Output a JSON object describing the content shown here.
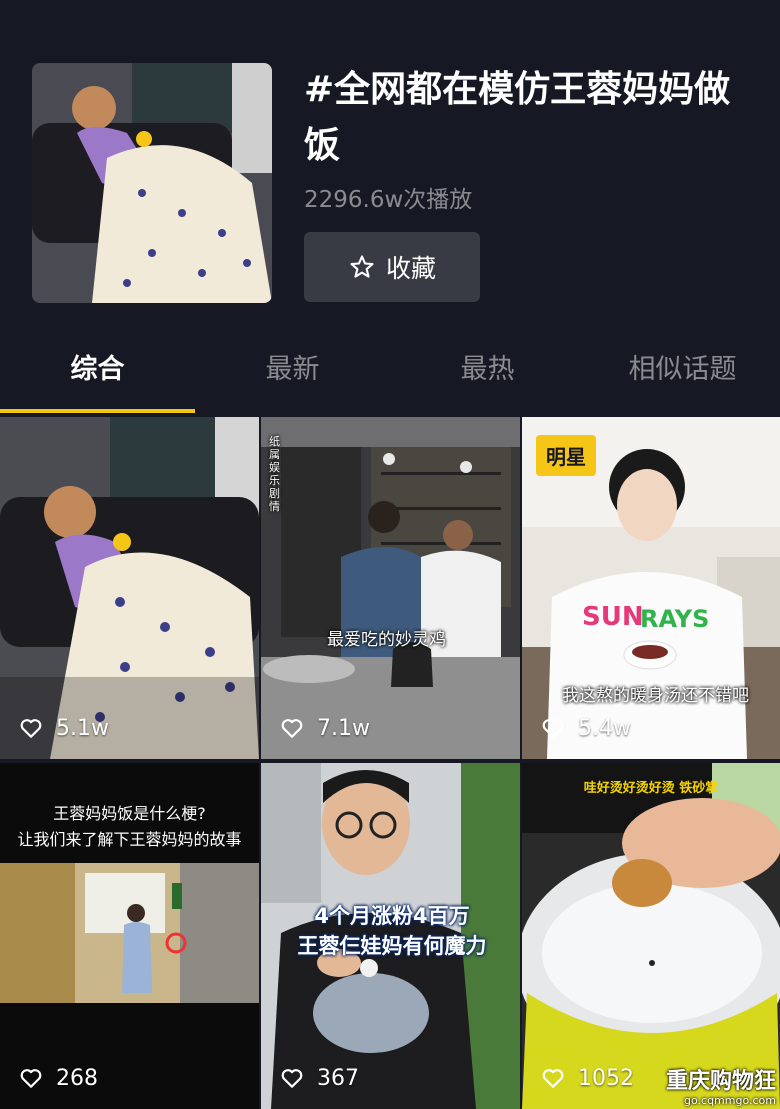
{
  "topic": {
    "title": "#全网都在模仿王蓉妈妈做饭",
    "plays": "2296.6w次播放",
    "favorite_label": "收藏"
  },
  "tabs": [
    {
      "label": "综合",
      "active": true
    },
    {
      "label": "最新",
      "active": false
    },
    {
      "label": "最热",
      "active": false
    },
    {
      "label": "相似话题",
      "active": false
    }
  ],
  "videos": [
    {
      "likes": "5.1w"
    },
    {
      "likes": "7.1w",
      "caption": "最爱吃的妙灵鸡",
      "side_text": "纸属娱乐剧情"
    },
    {
      "likes": "5.4w",
      "badge": "明星",
      "caption": "我这熬的暖身汤还不错吧"
    },
    {
      "likes": "268",
      "caption_line1": "王蓉妈妈饭是什么梗?",
      "caption_line2": "让我们来了解下王蓉妈妈的故事"
    },
    {
      "likes": "367",
      "caption_line1": "4个月涨粉4百万",
      "caption_line2": "王蓉仨娃妈有何魔力"
    },
    {
      "likes": "1052",
      "caption": "哇好烫好烫好烫 铁砂掌"
    }
  ],
  "watermark": {
    "main": "重庆购物狂",
    "sub": "go.cqmmgo.com"
  },
  "colors": {
    "background": "#161823",
    "accent": "#f5c518",
    "secondary_text": "#8a8b91"
  }
}
